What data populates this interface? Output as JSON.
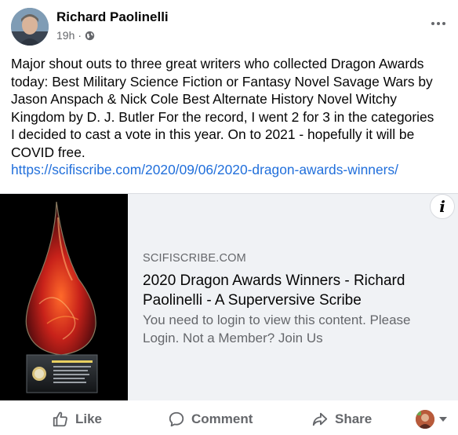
{
  "post": {
    "author": "Richard Paolinelli",
    "time": "19h",
    "separator": "·",
    "text_lines": [
      "Major shout outs to three great writers who collected Dragon Awards",
      "today: Best Military Science Fiction or Fantasy Novel Savage Wars by",
      "Jason Anspach & Nick Cole  Best Alternate History Novel Witchy",
      "Kingdom by D. J. Butler For the record, I went 2 for 3 in the categories",
      "I decided to cast a vote in this year. On to 2021 - hopefully it will be",
      "COVID free."
    ],
    "link": "https://scifiscribe.com/2020/09/06/2020-dragon-awards-winners/"
  },
  "card": {
    "domain": "SCIFISCRIBE.COM",
    "title_lines": [
      "2020 Dragon Awards Winners - Richard",
      "Paolinelli - A Superversive Scribe"
    ],
    "desc_lines": [
      "You need to login to view this content. Please",
      "Login. Not a Member? Join Us"
    ],
    "info_glyph": "i",
    "image_icon": "dragon-award-trophy-image"
  },
  "actions": {
    "like": "Like",
    "comment": "Comment",
    "share": "Share"
  },
  "colors": {
    "link": "#216fdb",
    "secondary_text": "#65676b",
    "card_bg": "#f0f2f5"
  }
}
